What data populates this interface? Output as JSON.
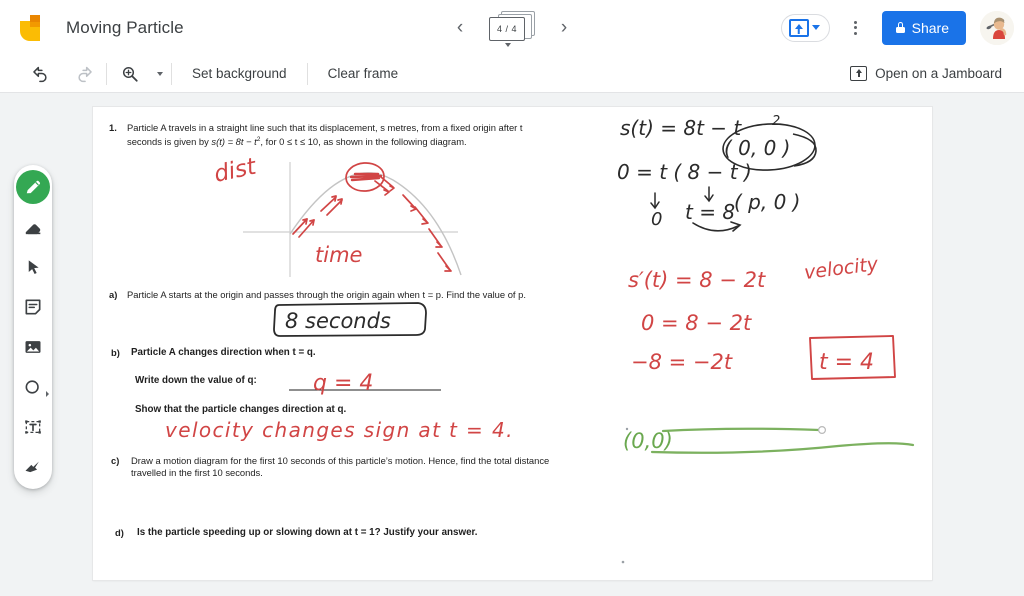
{
  "app": {
    "name": "Jamboard",
    "title": "Moving Particle",
    "logo_icon": "jamboard-logo-icon"
  },
  "header": {
    "prev_label": "‹",
    "next_label": "›",
    "frame_counter": "4 / 4",
    "frame_icon": "frames-stack-icon",
    "present_icon": "present-upload-icon",
    "present_caret_icon": "chevron-down-icon",
    "more_icon": "kebab-menu-icon",
    "share_label": "Share",
    "share_lock_icon": "lock-icon",
    "share_color": "#1a73e8",
    "avatar_icon": "user-avatar"
  },
  "toolbar": {
    "undo_icon": "undo-icon",
    "redo_icon": "redo-icon",
    "zoom_icon": "zoom-in-icon",
    "zoom_caret_icon": "chevron-down-icon",
    "set_background_label": "Set background",
    "clear_frame_label": "Clear frame",
    "open_jamboard_label": "Open on a Jamboard",
    "open_jamboard_icon": "open-on-jamboard-icon"
  },
  "tool_rail": {
    "items": [
      {
        "name": "pen-tool",
        "icon": "pen-icon",
        "active": true,
        "color": "#34a853"
      },
      {
        "name": "eraser-tool",
        "icon": "eraser-icon",
        "active": false
      },
      {
        "name": "select-tool",
        "icon": "cursor-arrow-icon",
        "active": false
      },
      {
        "name": "sticky-note-tool",
        "icon": "sticky-note-icon",
        "active": false
      },
      {
        "name": "image-tool",
        "icon": "image-icon",
        "active": false
      },
      {
        "name": "shape-tool",
        "icon": "circle-shape-icon",
        "active": false
      },
      {
        "name": "text-box-tool",
        "icon": "text-box-icon",
        "active": false
      },
      {
        "name": "laser-tool",
        "icon": "laser-pointer-icon",
        "active": false
      }
    ]
  },
  "worksheet": {
    "q1_number": "1.",
    "q1_line1": "Particle A travels in a straight line such that its displacement, s metres, from a fixed origin after t",
    "q1_line2_a": "seconds is given by ",
    "q1_line2_formula": "s(t) = 8t − t",
    "q1_line2_sup": "2",
    "q1_line2_b": ", for 0 ≤ t ≤ 10, as shown in the following diagram.",
    "part_a_label": "a)",
    "part_a_text": "Particle A starts at the origin and passes through the origin again when t = p.  Find the value of p.",
    "part_b_label": "b)",
    "part_b_text": "Particle A changes direction when t = q.",
    "part_b_prompt": "Write down the value of q:",
    "part_b_show": "Show that the particle changes direction at q.",
    "part_c_label": "c)",
    "part_c_line1": "Draw a motion diagram for the first 10 seconds of this particle’s motion.  Hence, find the total distance",
    "part_c_line2": "travelled in the first 10 seconds.",
    "part_d_label": "d)",
    "part_d_text": "Is the particle speeding up or slowing down at t = 1?  Justify your answer."
  },
  "annotations": {
    "ink_red": "#d93a3a",
    "ink_black": "#1f1f1f",
    "ink_green": "#6aa84f",
    "graph_axis_color": "#c8c8c8",
    "diagram_label_dist": "dist",
    "diagram_label_time": "time",
    "answer_a": "8 seconds",
    "answer_b": "q = 4",
    "answer_show": "velocity changes sign at t = 4.",
    "work_black_line1": "s(t) = 8t − t",
    "work_black_line1_sup": "2",
    "work_black_line2": "0 =     t ( 8 − t )",
    "work_black_zero": "0",
    "work_black_t8": "t = 8",
    "work_black_point1": "( 0, 0 )",
    "work_black_point2": "( p, 0 )",
    "work_red_line1": "s′(t) = 8 − 2t",
    "work_red_velocity": "velocity",
    "work_red_line2": "0  =  8 − 2t",
    "work_red_line3": "−8 = −2t",
    "work_red_boxed": "t = 4",
    "work_green_point": "(0,0)"
  }
}
